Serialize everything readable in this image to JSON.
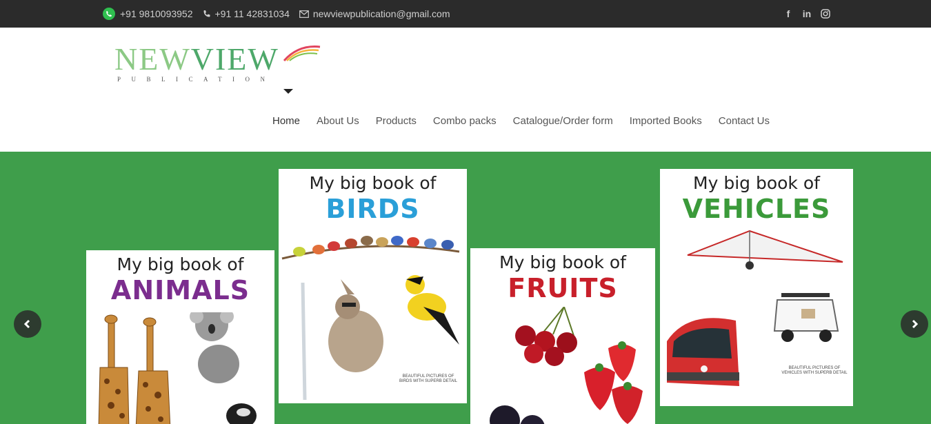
{
  "topbar": {
    "whatsapp": "+91 9810093952",
    "phone": "+91 11 42831034",
    "email": "newviewpublication@gmail.com",
    "social": [
      {
        "icon": "facebook-icon",
        "glyph": "f"
      },
      {
        "icon": "linkedin-icon",
        "glyph": "in"
      },
      {
        "icon": "instagram-icon",
        "glyph": "◎"
      }
    ]
  },
  "logo": {
    "word_new": "NEW",
    "word_view": "VIEW",
    "sub": "PUBLICATION"
  },
  "nav": {
    "items": [
      "Home",
      "About Us",
      "Products",
      "Combo packs",
      "Catalogue/Order form",
      "Imported Books",
      "Contact Us"
    ],
    "active": "Home"
  },
  "slider": {
    "books": [
      {
        "line1": "My big book of",
        "line2": "ANIMALS",
        "color": "#7b2d8e",
        "caption": ""
      },
      {
        "line1": "My big book of",
        "line2": "BIRDS",
        "color": "#2a9fd8",
        "caption": "BEAUTIFUL PICTURES OF BIRDS WITH SUPERB DETAIL"
      },
      {
        "line1": "My big book of",
        "line2": "FRUITS",
        "color": "#c8202b",
        "caption": ""
      },
      {
        "line1": "My big book of",
        "line2": "VEHICLES",
        "color": "#3b9a3a",
        "caption": "BEAUTIFUL PICTURES OF VEHICLES WITH SUPERB DETAIL"
      }
    ]
  },
  "colors": {
    "topbar_bg": "#2b2b2b",
    "slider_bg": "#3f9e4b",
    "arrow_bg": "#2d3b2f"
  }
}
